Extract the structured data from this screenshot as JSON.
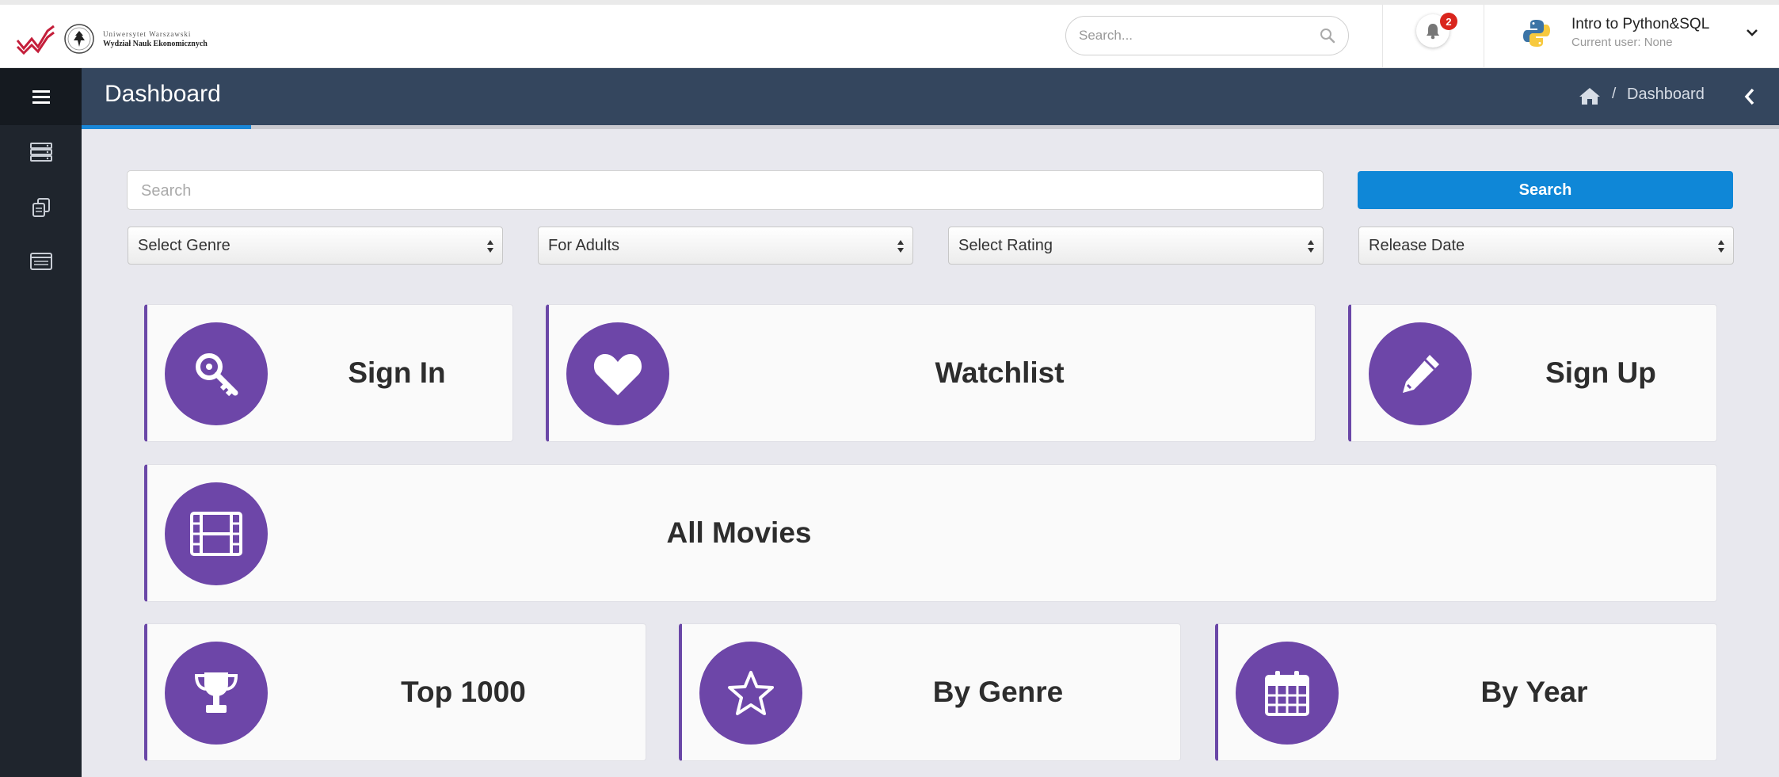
{
  "brand": {
    "logo_line1": "Uniwersytet Warszawski",
    "logo_line2": "Wydział Nauk Ekonomicznych"
  },
  "topbar": {
    "search_placeholder": "Search...",
    "notifications_count": "2",
    "user_title": "Intro to Python&SQL",
    "user_subtitle": "Current user: None"
  },
  "sidebar": {
    "items": [
      {
        "icon": "server-icon"
      },
      {
        "icon": "copy-icon"
      },
      {
        "icon": "list-icon"
      }
    ]
  },
  "header": {
    "title": "Dashboard",
    "breadcrumb_separator": "/",
    "breadcrumb_current": "Dashboard"
  },
  "page_progress_percent": 10,
  "filters": {
    "search_placeholder": "Search",
    "search_button": "Search",
    "genre": "Select Genre",
    "audience": "For Adults",
    "rating": "Select Rating",
    "sort": "Release Date"
  },
  "cards": {
    "sign_in": "Sign In",
    "watchlist": "Watchlist",
    "sign_up": "Sign Up",
    "all_movies": "All Movies",
    "top_1000": "Top 1000",
    "by_genre": "By Genre",
    "by_year": "By Year"
  },
  "colors": {
    "accent_purple": "#6d46a8",
    "primary_blue": "#0f87d7",
    "header_navy": "#34465e",
    "sidebar_dark": "#1f252d",
    "badge_red": "#d9251d"
  }
}
